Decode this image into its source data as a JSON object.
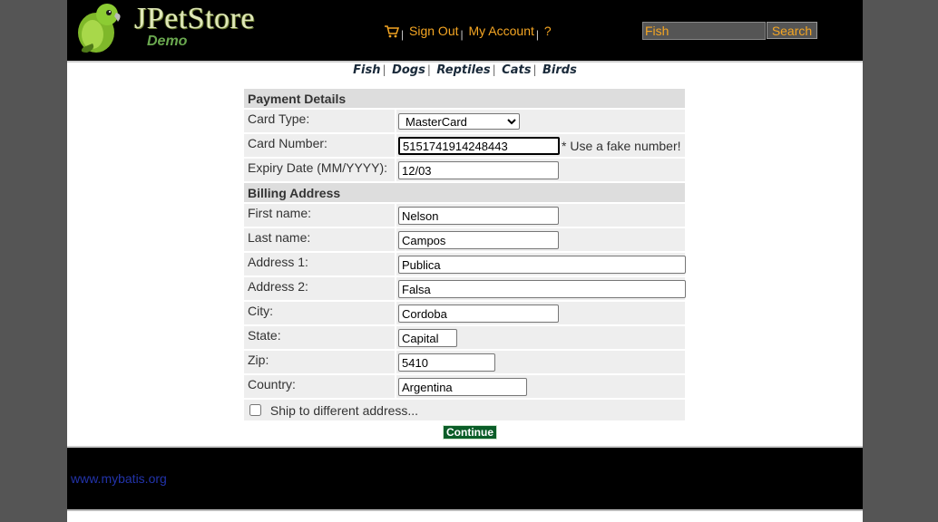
{
  "header": {
    "logo_title": "JPetStore",
    "logo_subtitle": "Demo",
    "menu": {
      "sign_out": "Sign Out",
      "my_account": "My Account",
      "help": "?"
    },
    "search": {
      "value": "Fish",
      "button_label": "Search"
    }
  },
  "quicklinks": [
    "Fish",
    "Dogs",
    "Reptiles",
    "Cats",
    "Birds"
  ],
  "payment": {
    "section_title": "Payment Details",
    "card_type_label": "Card Type:",
    "card_type_value": "MasterCard",
    "card_number_label": "Card Number:",
    "card_number_value": "5151741914248443",
    "card_number_note": "* Use a fake number!",
    "expiry_label": "Expiry Date (MM/YYYY):",
    "expiry_value": "12/03"
  },
  "billing": {
    "section_title": "Billing Address",
    "first_name_label": "First name:",
    "first_name_value": "Nelson",
    "last_name_label": "Last name:",
    "last_name_value": "Campos",
    "address1_label": "Address 1:",
    "address1_value": "Publica",
    "address2_label": "Address 2:",
    "address2_value": "Falsa",
    "city_label": "City:",
    "city_value": "Cordoba",
    "state_label": "State:",
    "state_value": "Capital",
    "zip_label": "Zip:",
    "zip_value": "5410",
    "country_label": "Country:",
    "country_value": "Argentina"
  },
  "ship_to_different_label": "Ship to different address...",
  "continue_label": "Continue",
  "footer": {
    "link_text": "www.mybatis.org"
  },
  "colors": {
    "header_bg": "#000000",
    "accent": "#f5a623",
    "continue_bg": "#0b5d28",
    "footer_link": "#2233aa"
  }
}
